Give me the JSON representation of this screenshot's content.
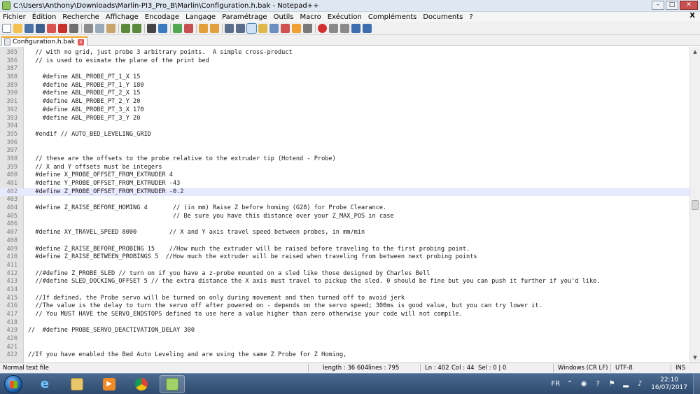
{
  "window": {
    "title": "C:\\Users\\Anthony\\Downloads\\Marlin-PI3_Pro_B\\Marlin\\Configuration.h.bak - Notepad++",
    "minimize": "–",
    "maximize": "□",
    "close": "✕"
  },
  "menu": {
    "items": [
      "Fichier",
      "Édition",
      "Recherche",
      "Affichage",
      "Encodage",
      "Langage",
      "Paramétrage",
      "Outils",
      "Macro",
      "Exécution",
      "Compléments",
      "Documents",
      "?"
    ],
    "close_doc": "X"
  },
  "tab": {
    "label": "Configuration.h.bak",
    "close": "x"
  },
  "editor": {
    "current_line": "402",
    "lines": [
      {
        "n": "385",
        "t": "  // with no grid, just probe 3 arbitrary points.  A simple cross-product"
      },
      {
        "n": "386",
        "t": "  // is used to esimate the plane of the print bed"
      },
      {
        "n": "387",
        "t": ""
      },
      {
        "n": "388",
        "t": "    #define ABL_PROBE_PT_1_X 15"
      },
      {
        "n": "389",
        "t": "    #define ABL_PROBE_PT_1_Y 180"
      },
      {
        "n": "390",
        "t": "    #define ABL_PROBE_PT_2_X 15"
      },
      {
        "n": "391",
        "t": "    #define ABL_PROBE_PT_2_Y 20"
      },
      {
        "n": "392",
        "t": "    #define ABL_PROBE_PT_3_X 170"
      },
      {
        "n": "393",
        "t": "    #define ABL_PROBE_PT_3_Y 20"
      },
      {
        "n": "394",
        "t": ""
      },
      {
        "n": "395",
        "t": "  #endif // AUTO_BED_LEVELING_GRID"
      },
      {
        "n": "396",
        "t": ""
      },
      {
        "n": "397",
        "t": ""
      },
      {
        "n": "398",
        "t": "  // these are the offsets to the probe relative to the extruder tip (Hotend - Probe)"
      },
      {
        "n": "399",
        "t": "  // X and Y offsets must be integers"
      },
      {
        "n": "400",
        "t": "  #define X_PROBE_OFFSET_FROM_EXTRUDER 4"
      },
      {
        "n": "401",
        "t": "  #define Y_PROBE_OFFSET_FROM_EXTRUDER -43"
      },
      {
        "n": "402",
        "t": "  #define Z_PROBE_OFFSET_FROM_EXTRUDER -0.2"
      },
      {
        "n": "403",
        "t": ""
      },
      {
        "n": "404",
        "t": "  #define Z_RAISE_BEFORE_HOMING 4       // (in mm) Raise Z before homing (G28) for Probe Clearance."
      },
      {
        "n": "405",
        "t": "                                        // Be sure you have this distance over your Z_MAX_POS in case"
      },
      {
        "n": "406",
        "t": ""
      },
      {
        "n": "407",
        "t": "  #define XY_TRAVEL_SPEED 8000         // X and Y axis travel speed between probes, in mm/min"
      },
      {
        "n": "408",
        "t": ""
      },
      {
        "n": "409",
        "t": "  #define Z_RAISE_BEFORE_PROBING 15    //How much the extruder will be raised before traveling to the first probing point."
      },
      {
        "n": "410",
        "t": "  #define Z_RAISE_BETWEEN_PROBINGS 5  //How much the extruder will be raised when traveling from between next probing points"
      },
      {
        "n": "411",
        "t": ""
      },
      {
        "n": "412",
        "t": "  //#define Z_PROBE_SLED // turn on if you have a z-probe mounted on a sled like those designed by Charles Bell"
      },
      {
        "n": "413",
        "t": "  //#define SLED_DOCKING_OFFSET 5 // the extra distance the X axis must travel to pickup the sled. 0 should be fine but you can push it further if you'd like."
      },
      {
        "n": "414",
        "t": ""
      },
      {
        "n": "415",
        "t": "  //If defined, the Probe servo will be turned on only during movement and then turned off to avoid jerk"
      },
      {
        "n": "416",
        "t": "  //The value is the delay to turn the servo off after powered on - depends on the servo speed; 300ms is good value, but you can try lower it."
      },
      {
        "n": "417",
        "t": "  // You MUST HAVE the SERVO_ENDSTOPS defined to use here a value higher than zero otherwise your code will not compile."
      },
      {
        "n": "418",
        "t": ""
      },
      {
        "n": "419",
        "t": "//  #define PROBE_SERVO_DEACTIVATION_DELAY 300"
      },
      {
        "n": "420",
        "t": ""
      },
      {
        "n": "421",
        "t": ""
      },
      {
        "n": "422",
        "t": "//If you have enabled the Bed Auto Leveling and are using the same Z Probe for Z Homing,"
      }
    ]
  },
  "status": {
    "file_type": "Normal text file",
    "length": "length : 36 604",
    "lines": "lines : 795",
    "ln": "Ln : 402",
    "col": "Col : 44",
    "sel": "Sel : 0 | 0",
    "eol": "Windows (CR LF)",
    "encoding": "UTF-8",
    "mode": "INS"
  },
  "taskbar": {
    "language": "FR",
    "time": "22:10",
    "date": "16/07/2017"
  },
  "colors": {
    "current_line_bg": "#e8e8ff",
    "tab_accent": "#f5a623"
  }
}
